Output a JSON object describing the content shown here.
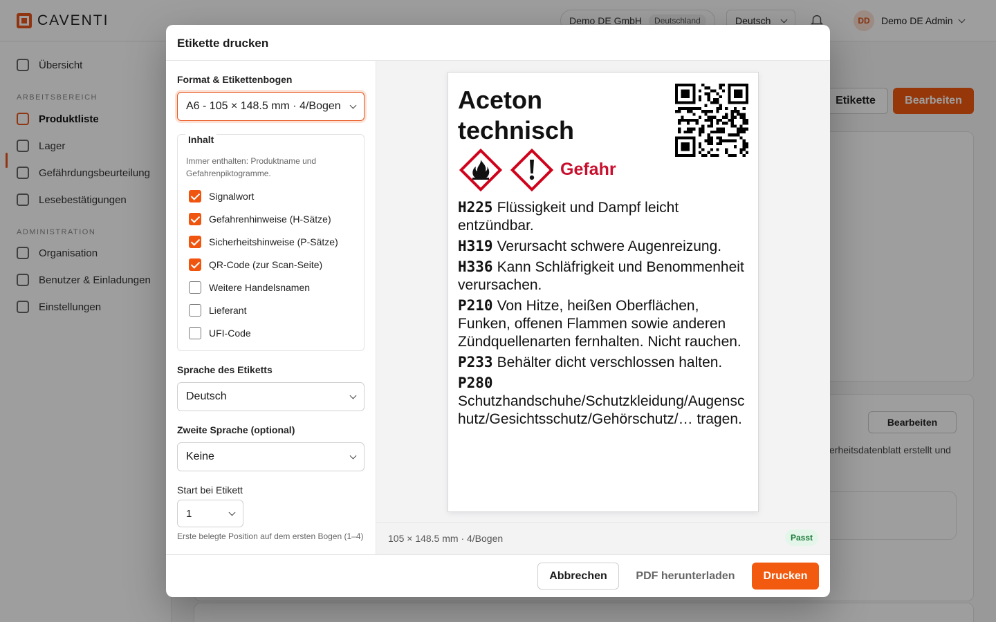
{
  "app": {
    "brand": "CAVENTI",
    "org_name": "Demo DE GmbH",
    "org_country": "Deutschland",
    "language": "Deutsch",
    "user_initials": "DD",
    "user_name": "Demo DE Admin"
  },
  "sidebar": {
    "overview": "Übersicht",
    "section_work": "ARBEITSBEREICH",
    "items_work": [
      "Produktliste",
      "Lager",
      "Gefährdungsbeurteilung",
      "Lesebestätigungen"
    ],
    "section_admin": "ADMINISTRATION",
    "items_admin": [
      "Organisation",
      "Benutzer & Einladungen",
      "Einstellungen"
    ]
  },
  "background": {
    "label_button": "Etikette",
    "edit_button": "Bearbeiten",
    "edit_button_2": "Bearbeiten",
    "sds_text": "erheitsdatenblatt erstellt und"
  },
  "dialog": {
    "title": "Etikette drucken",
    "format_label": "Format & Etikettenbogen",
    "format_value": "A6 - 105 × 148.5 mm · 4/Bogen",
    "content_legend": "Inhalt",
    "content_hint": "Immer enthalten: Produktname und Gefahrenpiktogramme.",
    "options": [
      {
        "label": "Signalwort",
        "checked": true
      },
      {
        "label": "Gefahrenhinweise (H-Sätze)",
        "checked": true
      },
      {
        "label": "Sicherheitshinweise (P-Sätze)",
        "checked": true
      },
      {
        "label": "QR-Code (zur Scan-Seite)",
        "checked": true
      },
      {
        "label": "Weitere Handelsnamen",
        "checked": false
      },
      {
        "label": "Lieferant",
        "checked": false
      },
      {
        "label": "UFI-Code",
        "checked": false
      }
    ],
    "language_label": "Sprache des Etiketts",
    "language_value": "Deutsch",
    "second_language_label": "Zweite Sprache (optional)",
    "second_language_value": "Keine",
    "start_label": "Start bei Etikett",
    "start_value": "1",
    "start_hint": "Erste belegte Position auf dem ersten Bogen (1–4)",
    "preview_format": "105 × 148.5 mm · 4/Bogen",
    "fit_badge": "Passt",
    "cancel": "Abbrechen",
    "download_pdf": "PDF herunterladen",
    "print": "Drucken"
  },
  "label_preview": {
    "product_name": "Aceton technisch",
    "signal_word": "Gefahr",
    "pictograms": [
      "flame-pictogram",
      "exclamation-pictogram"
    ],
    "phrases": [
      {
        "code": "H225",
        "text": "Flüssigkeit und Dampf leicht entzündbar."
      },
      {
        "code": "H319",
        "text": "Verursacht schwere Augenreizung."
      },
      {
        "code": "H336",
        "text": "Kann Schläfrigkeit und Benommenheit verursachen."
      },
      {
        "code": "P210",
        "text": "Von Hitze, heißen Oberflächen, Funken, offenen Flammen sowie anderen Zündquellenarten fernhalten. Nicht rauchen."
      },
      {
        "code": "P233",
        "text": "Behälter dicht verschlossen halten."
      },
      {
        "code": "P280",
        "text": "Schutzhandschuhe/Schutzkleidung/Augenschutz/Gesichtsschutz/Gehörschutz/… tragen."
      }
    ]
  },
  "colors": {
    "accent": "#f25a0f",
    "signal": "#c8102e",
    "fit": "#1c7a3a"
  }
}
